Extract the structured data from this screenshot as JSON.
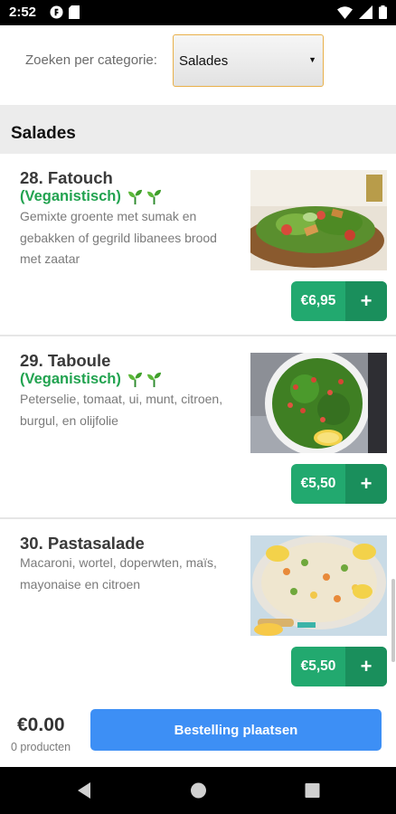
{
  "status_bar": {
    "time": "2:52"
  },
  "category_picker": {
    "label": "Zoeken per categorie:",
    "selected": "Salades"
  },
  "section": {
    "title": "Salades"
  },
  "items": [
    {
      "title": "28. Fatouch",
      "tag": "(Veganistisch)",
      "desc_lines": [
        "Gemixte groente met sumak en",
        "gebakken of gegrild libanees brood",
        "met zaatar"
      ],
      "price": "€6,95",
      "plus": "+"
    },
    {
      "title": "29. Taboule",
      "tag": "(Veganistisch)",
      "desc_lines": [
        "Peterselie, tomaat, ui, munt, citroen,",
        "burgul, en olijfolie"
      ],
      "price": "€5,50",
      "plus": "+"
    },
    {
      "title": "30. Pastasalade",
      "desc_lines": [
        "Macaroni, wortel, doperwten, maïs,",
        "mayonaise en citroen"
      ],
      "price": "€5,50",
      "plus": "+"
    }
  ],
  "order_bar": {
    "total": "€0.00",
    "count": "0 producten",
    "button": "Bestelling plaatsen"
  },
  "colors": {
    "green": "#22a96f",
    "tag_green": "#22a350",
    "blue": "#3d8ff5",
    "picker_border": "#e8b04a"
  }
}
